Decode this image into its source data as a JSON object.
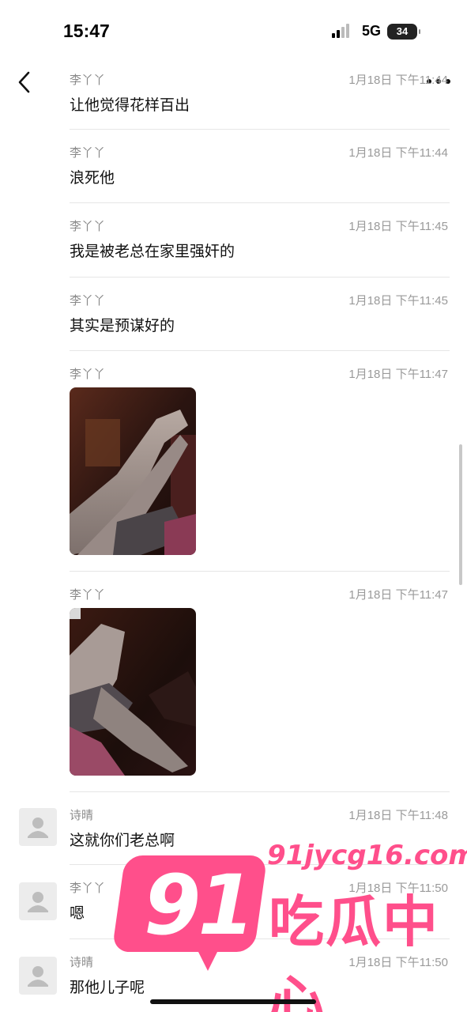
{
  "status_bar": {
    "time": "15:47",
    "network": "5G",
    "battery": "34"
  },
  "messages": [
    {
      "sender": "李丫丫",
      "time": "1月18日 下午11:44",
      "text": "让他觉得花样百出",
      "avatar": false
    },
    {
      "sender": "李丫丫",
      "time": "1月18日 下午11:44",
      "text": "浪死他",
      "avatar": false
    },
    {
      "sender": "李丫丫",
      "time": "1月18日 下午11:45",
      "text": "我是被老总在家里强奸的",
      "avatar": false
    },
    {
      "sender": "李丫丫",
      "time": "1月18日 下午11:45",
      "text": "其实是预谋好的",
      "avatar": false
    },
    {
      "sender": "李丫丫",
      "time": "1月18日 下午11:47",
      "image": "photo-legs-sitting",
      "avatar": false
    },
    {
      "sender": "李丫丫",
      "time": "1月18日 下午11:47",
      "image": "photo-legs-crossed",
      "avatar": false
    },
    {
      "sender": "诗晴",
      "time": "1月18日 下午11:48",
      "text": "这就你们老总啊",
      "avatar": true
    },
    {
      "sender": "李丫丫",
      "time": "1月18日 下午11:50",
      "text": "嗯",
      "avatar": true
    },
    {
      "sender": "诗晴",
      "time": "1月18日 下午11:50",
      "text": "那他儿子呢",
      "avatar": true
    }
  ],
  "icons": {
    "back": "chevron-left-icon",
    "more": "more-dots-icon",
    "avatar": "default-avatar-icon"
  },
  "watermark": {
    "number": "91",
    "url": "91jycg16.com",
    "name": "吃瓜中心",
    "color": "#ff4f8b"
  }
}
